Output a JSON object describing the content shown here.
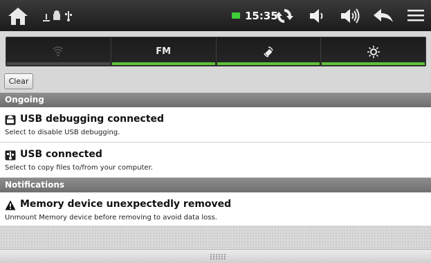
{
  "status_bar": {
    "time": "15:35",
    "icons": [
      "home-icon",
      "android-debug-icon",
      "usb-icon",
      "battery-icon",
      "sync-icon",
      "volume-down-icon",
      "volume-up-icon",
      "back-icon",
      "menu-icon"
    ],
    "battery_color": "#3ecf3a"
  },
  "toggles": [
    {
      "name": "wifi",
      "label": "",
      "icon": "wifi-icon",
      "on": false
    },
    {
      "name": "fm",
      "label": "FM",
      "icon": "",
      "on": true
    },
    {
      "name": "auto-rotate",
      "label": "",
      "icon": "rotate-icon",
      "on": true
    },
    {
      "name": "brightness",
      "label": "",
      "icon": "brightness-icon",
      "on": true
    }
  ],
  "clear_label": "Clear",
  "sections": {
    "ongoing": "Ongoing",
    "notifications": "Notifications"
  },
  "notifications": [
    {
      "title": "USB debugging connected",
      "text": "Select to disable USB debugging.",
      "icon": "android-debug-icon"
    },
    {
      "title": "USB connected",
      "text": "Select to copy files to/from your computer.",
      "icon": "usb-icon"
    },
    {
      "title": "Memory device unexpectedly removed",
      "text": "Unmount Memory device before removing to avoid data loss.",
      "icon": "warning-icon"
    }
  ],
  "accent_color": "#5ec43a"
}
